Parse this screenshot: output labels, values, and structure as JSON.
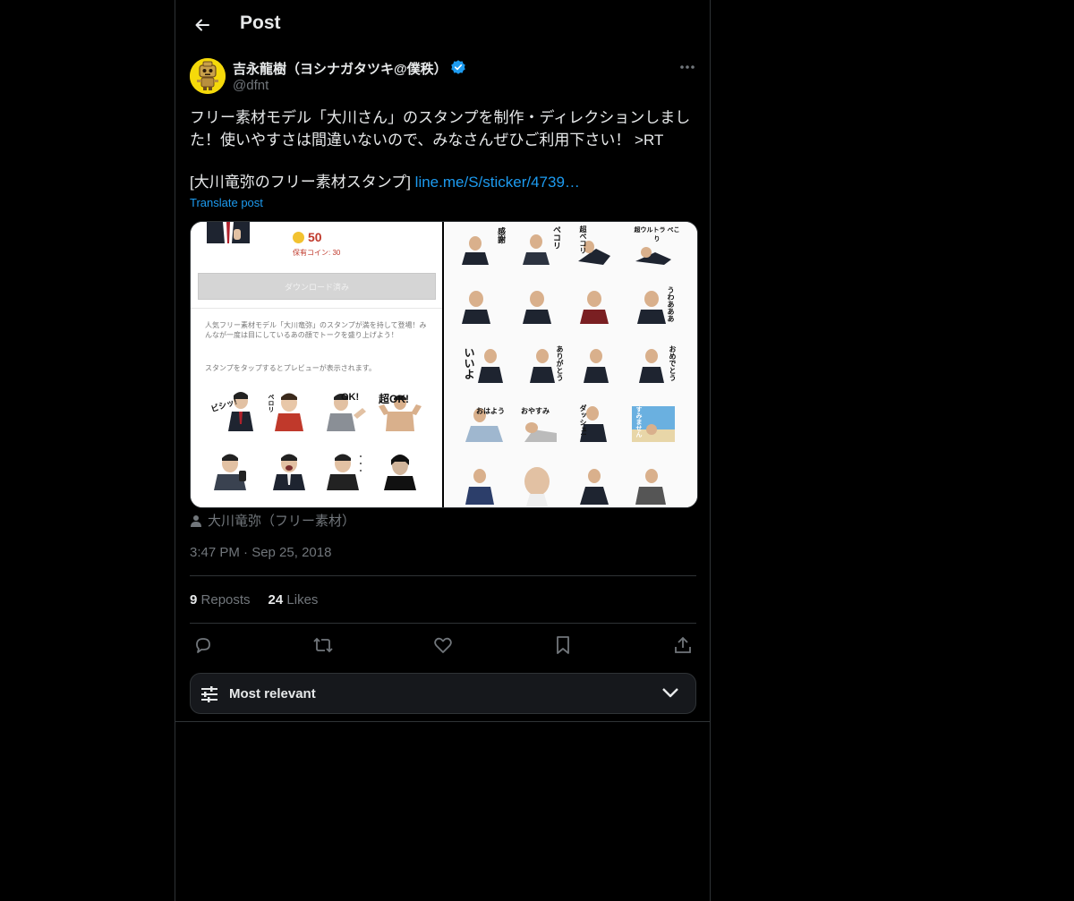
{
  "header": {
    "title": "Post"
  },
  "post": {
    "author": {
      "display_name": "吉永龍樹（ヨシナガタツキ@僕秩）",
      "handle": "@dfnt"
    },
    "text_lines": [
      "フリー素材モデル「大川さん」のスタンプを制作・ディレクションしまし",
      "た！使いやすさは間違いないので、みなさんぜひご利用下さい！ >RT"
    ],
    "link_prefix": "[大川竜弥のフリー素材スタンプ] ",
    "link_text": "line.me/S/sticker/4739…",
    "translate_label": "Translate post",
    "media": {
      "left": {
        "price": "50",
        "coins_owned": "保有コイン: 30",
        "download_label": "ダウンロード済み",
        "description": "人気フリー素材モデル「大川竜弥」のスタンプが満を持して登場！みんなが一度は目にしているあの顔でトークを盛り上げよう！",
        "tap_hint": "スタンプをタップするとプレビューが表示されます。",
        "captions": [
          "ビシッ!",
          "ペロリ",
          "OK!",
          "超OK!"
        ]
      },
      "right": {
        "captions": [
          "感謝",
          "ペコリ",
          "超ペコリ",
          "超ウルトラ ペこり",
          "",
          "",
          "",
          "うわあああ",
          "いいよ",
          "",
          "ありがとう",
          "おめでとう",
          "おはよう",
          "おやすみ",
          "ダッシュ!",
          "すみません",
          "",
          "",
          "",
          ""
        ]
      }
    },
    "photo_credit": "大川竜弥（フリー素材）",
    "timestamp": "3:47 PM · Sep 25, 2018",
    "stats": {
      "reposts_count": "9",
      "reposts_label": "Reposts",
      "likes_count": "24",
      "likes_label": "Likes"
    }
  },
  "sort": {
    "label": "Most relevant"
  },
  "colors": {
    "background": "#000000",
    "text": "#e7e9ea",
    "muted": "#71767b",
    "accent": "#1d9bf0",
    "border": "#2f3336"
  },
  "icons": [
    "back-arrow-icon",
    "verified-badge-icon",
    "more-icon",
    "person-icon",
    "reply-icon",
    "repost-icon",
    "like-icon",
    "bookmark-icon",
    "share-icon",
    "sliders-icon",
    "chevron-down-icon"
  ]
}
